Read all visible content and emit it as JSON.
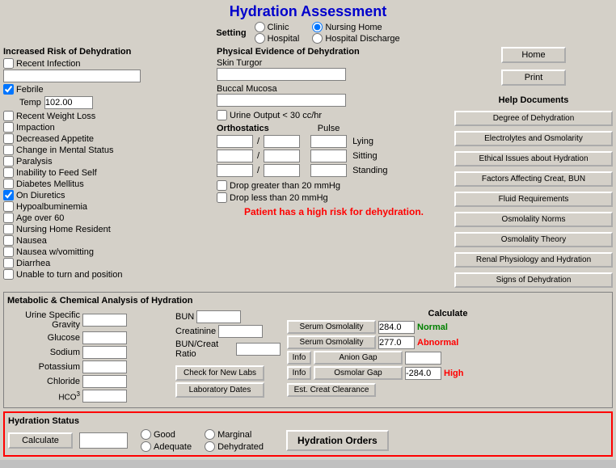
{
  "title": "Hydration Assessment",
  "setting": {
    "label": "Setting",
    "options": [
      {
        "id": "clinic",
        "label": "Clinic",
        "checked": false
      },
      {
        "id": "nursing_home",
        "label": "Nursing Home",
        "checked": true
      },
      {
        "id": "hospital",
        "label": "Hospital",
        "checked": false
      },
      {
        "id": "hospital_discharge",
        "label": "Hospital Discharge",
        "checked": false
      }
    ]
  },
  "increased_risk": {
    "header": "Increased Risk of Dehydration",
    "items": [
      {
        "id": "recent_infection",
        "label": "Recent Infection",
        "checked": false
      },
      {
        "id": "febrile",
        "label": "Febrile",
        "checked": true
      },
      {
        "id": "temp_label",
        "label": "Temp"
      },
      {
        "id": "recent_weight_loss",
        "label": "Recent Weight Loss",
        "checked": false
      },
      {
        "id": "impaction",
        "label": "Impaction",
        "checked": false
      },
      {
        "id": "decreased_appetite",
        "label": "Decreased Appetite",
        "checked": false
      },
      {
        "id": "change_mental_status",
        "label": "Change in Mental Status",
        "checked": false
      },
      {
        "id": "paralysis",
        "label": "Paralysis",
        "checked": false
      },
      {
        "id": "inability_feed_self",
        "label": "Inability to Feed Self",
        "checked": false
      },
      {
        "id": "diabetes_mellitus",
        "label": "Diabetes Mellitus",
        "checked": false
      },
      {
        "id": "on_diuretics",
        "label": "On Diuretics",
        "checked": true
      },
      {
        "id": "hypoalbuminemia",
        "label": "Hypoalbuminemia",
        "checked": false
      },
      {
        "id": "age_over_60",
        "label": "Age over 60",
        "checked": false
      },
      {
        "id": "nursing_home_resident",
        "label": "Nursing Home Resident",
        "checked": false
      },
      {
        "id": "nausea",
        "label": "Nausea",
        "checked": false
      },
      {
        "id": "nausea_vomitting",
        "label": "Nausea w/vomitting",
        "checked": false
      },
      {
        "id": "diarrhea",
        "label": "Diarrhea",
        "checked": false
      },
      {
        "id": "unable_turn_position",
        "label": "Unable to turn and position",
        "checked": false
      }
    ],
    "temp_value": "102.00"
  },
  "physical_evidence": {
    "header": "Physical Evidence of Dehydration",
    "skin_turgor_label": "Skin Turgor",
    "skin_turgor_value": "",
    "buccal_mucosa_label": "Buccal Mucosa",
    "buccal_mucosa_value": "",
    "urine_output_label": "Urine Output < 30 cc/hr",
    "urine_output_checked": false,
    "orthostatics_label": "Orthostatics",
    "pulse_label": "Pulse",
    "ortho_rows": [
      {
        "label": "Lying",
        "val1": "",
        "val2": "",
        "pulse": ""
      },
      {
        "label": "Sitting",
        "val1": "",
        "val2": "",
        "pulse": ""
      },
      {
        "label": "Standing",
        "val1": "",
        "val2": "",
        "pulse": ""
      }
    ],
    "drop_20_label": "Drop greater than 20 mmHg",
    "drop_20_checked": false,
    "drop_less_20_label": "Drop less than 20 mmHg",
    "drop_less_20_checked": false
  },
  "high_risk_message": "Patient has a high risk for dehydration.",
  "right_panel": {
    "home_btn": "Home",
    "print_btn": "Print",
    "help_docs_header": "Help Documents",
    "help_buttons": [
      "Degree of Dehydration",
      "Electrolytes and Osmolarity",
      "Ethical Issues about Hydration",
      "Factors Affecting Creat, BUN",
      "Fluid Requirements",
      "Osmolality Norms",
      "Osmolality Theory",
      "Renal Physiology and Hydration",
      "Signs of Dehydration"
    ]
  },
  "metabolic": {
    "header": "Metabolic & Chemical Analysis of Hydration",
    "left_fields": [
      {
        "label": "Urine Specific Gravity",
        "value": ""
      },
      {
        "label": "Glucose",
        "value": ""
      },
      {
        "label": "Sodium",
        "value": ""
      },
      {
        "label": "Potassium",
        "value": ""
      },
      {
        "label": "Chloride",
        "value": ""
      },
      {
        "label": "HCO3",
        "value": ""
      }
    ],
    "right_fields": [
      {
        "label": "BUN",
        "value": ""
      },
      {
        "label": "Creatinine",
        "value": ""
      },
      {
        "label": "BUN/Creat Ratio",
        "value": ""
      }
    ],
    "calculate_label": "Calculate",
    "calc_rows": [
      {
        "label": "Serum Osmolality",
        "value": "284.0",
        "status": "Normal",
        "status_class": "status-normal",
        "has_info": false
      },
      {
        "label": "Serum Osmolality",
        "value": "277.0",
        "status": "Abnormal",
        "status_class": "status-abnormal",
        "has_info": false
      },
      {
        "label": "Anion Gap",
        "value": "",
        "status": "",
        "status_class": "",
        "has_info": true
      },
      {
        "label": "Osmolar Gap",
        "value": "-284.0",
        "status": "High",
        "status_class": "status-high",
        "has_info": true
      }
    ],
    "est_creat_btn": "Est. Creat Clearance",
    "check_new_labs_btn": "Check for New Labs",
    "laboratory_dates_btn": "Laboratory Dates"
  },
  "hydration_status": {
    "header": "Hydration Status",
    "calculate_btn": "Calculate",
    "radio_options": [
      {
        "label": "Good",
        "checked": false
      },
      {
        "label": "Marginal",
        "checked": false
      },
      {
        "label": "Adequate",
        "checked": false
      },
      {
        "label": "Dehydrated",
        "checked": false
      }
    ],
    "orders_btn": "Hydration Orders"
  }
}
